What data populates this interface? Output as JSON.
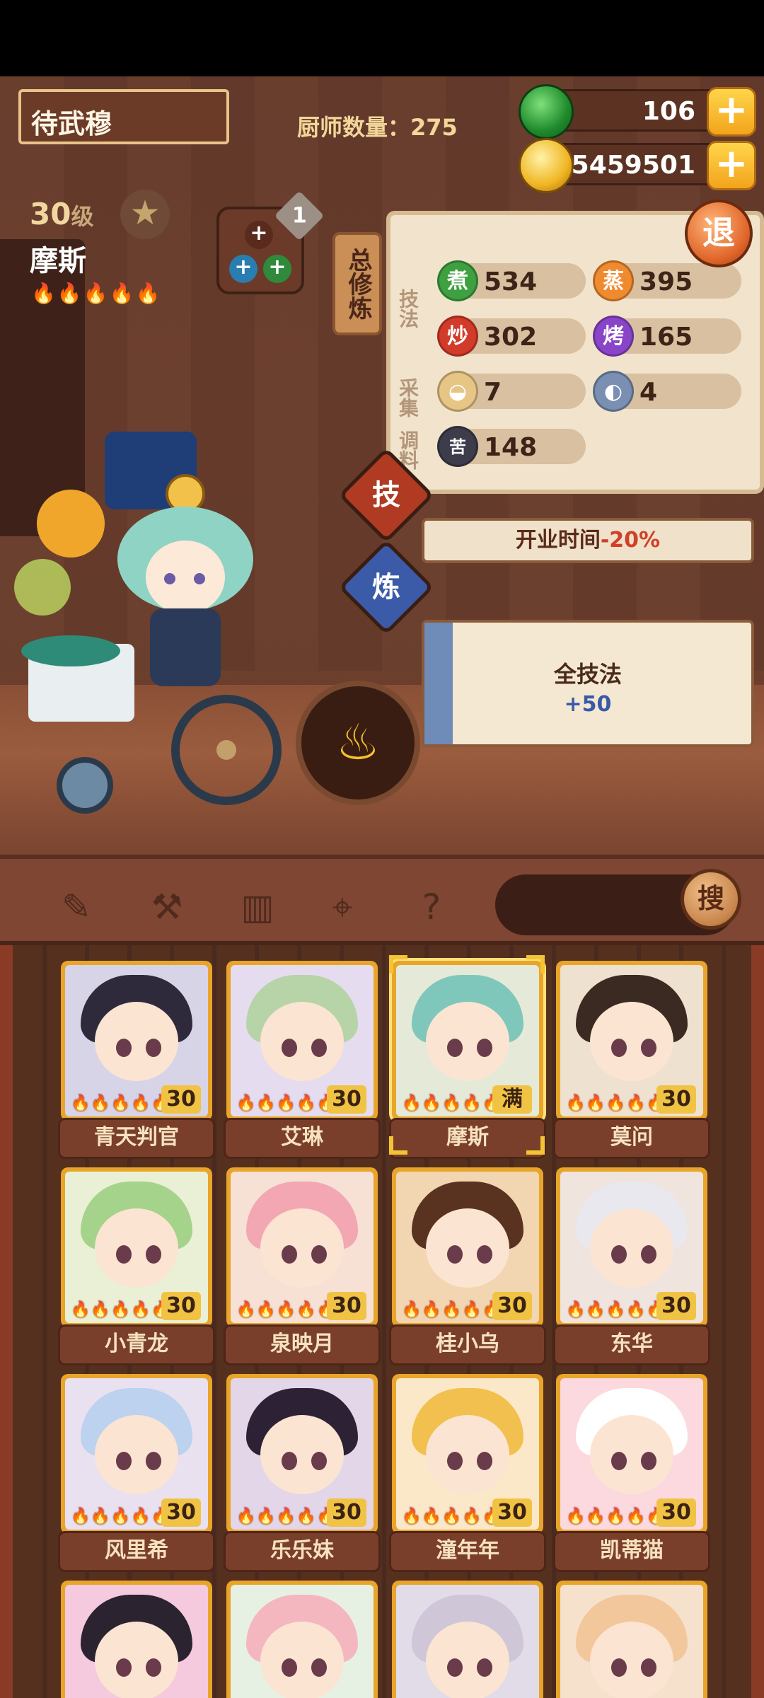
{
  "header": {
    "player_name": "待武穆",
    "chef_count_label": "厨师数量：",
    "chef_count": "275",
    "jade": "106",
    "coins": "5459501",
    "retreat_label": "退"
  },
  "chef": {
    "level": "30",
    "level_unit": "级",
    "name": "摩斯",
    "flames": "🔥🔥🔥🔥🔥",
    "gear_badge": "1",
    "total_train_tab": "总修炼"
  },
  "skills": {
    "section_skill": "技法",
    "section_gather": "采集",
    "section_season": "调料",
    "items": [
      {
        "icon": "煮",
        "value": "534",
        "color": "#3ea041"
      },
      {
        "icon": "蒸",
        "value": "395",
        "color": "#f08a2e"
      },
      {
        "icon": "炒",
        "value": "302",
        "color": "#d23a2a"
      },
      {
        "icon": "烤",
        "value": "165",
        "color": "#8a44c8"
      },
      {
        "icon": "bun-icon",
        "value": "7",
        "color": "#e6c585"
      },
      {
        "icon": "fish-icon",
        "value": "4",
        "color": "#7a8fb2"
      },
      {
        "icon": "苦",
        "value": "148",
        "color": "#3c3c4a"
      }
    ]
  },
  "tabs": {
    "skill": "技",
    "train": "炼"
  },
  "effects": {
    "open_time_label": "开业时间",
    "open_time_value": "-20%",
    "all_skill_label": "全技法",
    "all_skill_value": "+50"
  },
  "toolbar": {
    "icons": [
      "knife-icon",
      "shovel-icon",
      "jar-icon",
      "location-icon",
      "map-question-icon"
    ],
    "search_placeholder": "",
    "search_button": "搜"
  },
  "chefs": [
    {
      "name": "青天判官",
      "level": "30",
      "hair": "#2e2a3c",
      "bg": "#d8d4e8"
    },
    {
      "name": "艾琳",
      "level": "30",
      "hair": "#b7d3a8",
      "bg": "#e6dcef"
    },
    {
      "name": "摩斯",
      "level": "满",
      "hair": "#7fc7bb",
      "bg": "#e5e9d8"
    },
    {
      "name": "莫问",
      "level": "30",
      "hair": "#3a2a22",
      "bg": "#efe1cf"
    },
    {
      "name": "小青龙",
      "level": "30",
      "hair": "#a6d38b",
      "bg": "#eaf0d5"
    },
    {
      "name": "泉映月",
      "level": "30",
      "hair": "#f3a7b3",
      "bg": "#f7e0d4"
    },
    {
      "name": "桂小乌",
      "level": "30",
      "hair": "#5a3220",
      "bg": "#f2d6b1"
    },
    {
      "name": "东华",
      "level": "30",
      "hair": "#e8e8ee",
      "bg": "#efe4de"
    },
    {
      "name": "风里希",
      "level": "30",
      "hair": "#bcd2ee",
      "bg": "#e9e0f0"
    },
    {
      "name": "乐乐妹",
      "level": "30",
      "hair": "#2d2235",
      "bg": "#e3d6e9"
    },
    {
      "name": "潼年年",
      "level": "30",
      "hair": "#f2c04e",
      "bg": "#fbe8c8"
    },
    {
      "name": "凯蒂猫",
      "level": "30",
      "hair": "#ffffff",
      "bg": "#fbd9df"
    },
    {
      "name": "",
      "level": "",
      "hair": "#2b2430",
      "bg": "#f5c9de"
    },
    {
      "name": "",
      "level": "",
      "hair": "#f4b7c0",
      "bg": "#e7f1e3"
    },
    {
      "name": "",
      "level": "",
      "hair": "#cfc6d8",
      "bg": "#e2dbe8"
    },
    {
      "name": "",
      "level": "",
      "hair": "#f3c79c",
      "bg": "#f6e2cc"
    }
  ]
}
